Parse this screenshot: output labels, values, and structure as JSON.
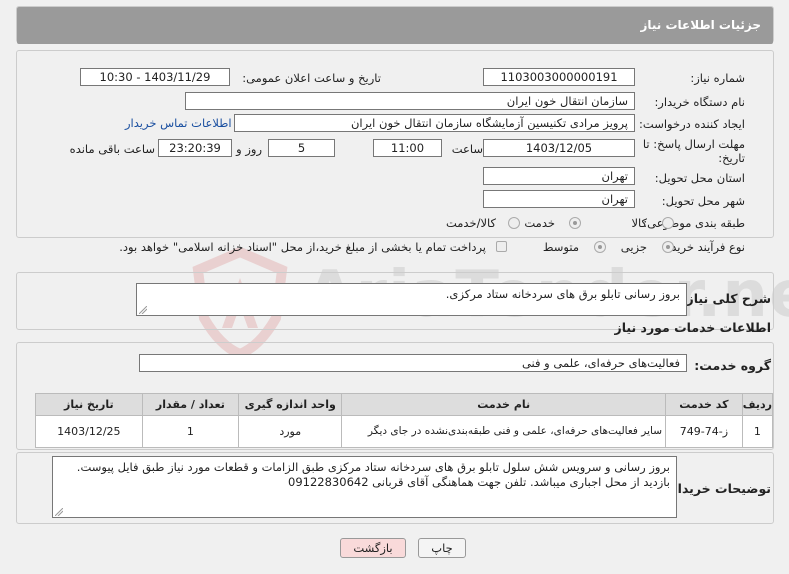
{
  "header": {
    "title": "جزئیات اطلاعات نیاز"
  },
  "form": {
    "need_number_label": "شماره نیاز:",
    "need_number": "1103003000000191",
    "announce_label": "تاریخ و ساعت اعلان عمومی:",
    "announce_value": "1403/11/29 - 10:30",
    "buyer_org_label": "نام دستگاه خریدار:",
    "buyer_org": "سازمان انتقال خون ایران",
    "requester_label": "ایجاد کننده درخواست:",
    "requester": "پرویز مرادی تکنیسین آزمایشگاه سازمان انتقال خون ایران",
    "contact_link": "اطلاعات تماس خریدار",
    "deadline_label_1": "مهلت ارسال پاسخ: تا",
    "deadline_label_2": "تاریخ:",
    "deadline_date": "1403/12/05",
    "time_label": "ساعت",
    "deadline_time": "11:00",
    "days_value": "5",
    "days_label": "روز و",
    "remaining_time": "23:20:39",
    "remaining_label": "ساعت باقی مانده",
    "province_label": "استان محل تحویل:",
    "province": "تهران",
    "city_label": "شهر محل تحویل:",
    "city": "تهران",
    "category_label": "طبقه بندی موضوعی:",
    "category_options": [
      "کالا",
      "خدمت",
      "کالا/خدمت"
    ],
    "category_selected": "خدمت",
    "process_label": "نوع فرآیند خرید :",
    "process_options": [
      "جزیی",
      "متوسط"
    ],
    "process_selected": "جزیی",
    "payment_note": "پرداخت تمام یا بخشی از مبلغ خرید،از محل \"اسناد خزانه اسلامی\" خواهد بود."
  },
  "summary": {
    "label": "شرح کلی نیاز:",
    "text": "بروز رسانی تابلو برق های سردخانه ستاد مرکزی."
  },
  "services": {
    "section_title": "اطلاعات خدمات مورد نیاز",
    "group_label": "گروه خدمت:",
    "group_value": "فعالیت‌های حرفه‌ای، علمی و فنی",
    "columns": [
      "ردیف",
      "کد خدمت",
      "نام خدمت",
      "واحد اندازه گیری",
      "تعداد / مقدار",
      "تاریخ نیاز"
    ],
    "rows": [
      {
        "index": "1",
        "code": "ز-74-749",
        "name": "سایر فعالیت‌های حرفه‌ای، علمی و فنی طبقه‌بندی‌نشده در جای دیگر",
        "unit": "مورد",
        "qty": "1",
        "date": "1403/12/25"
      }
    ]
  },
  "buyer_notes": {
    "label": "توضیحات خریدار:",
    "line1": "بروز رسانی و سرویس شش سلول تابلو برق های سردخانه ستاد مرکزی طبق الزامات و قطعات مورد نیاز طبق فایل پیوست.",
    "line2": "بازدید از محل اجباری میباشد.  تلفن جهت هماهنگی آقای قربانی  09122830642"
  },
  "buttons": {
    "print": "چاپ",
    "back": "بازگشت"
  },
  "watermark": {
    "text": "AriaTender.neT"
  },
  "colors": {
    "header_bg": "#9a9a9a",
    "link": "#1a4fa0",
    "back_button_bg": "#f9dada"
  }
}
